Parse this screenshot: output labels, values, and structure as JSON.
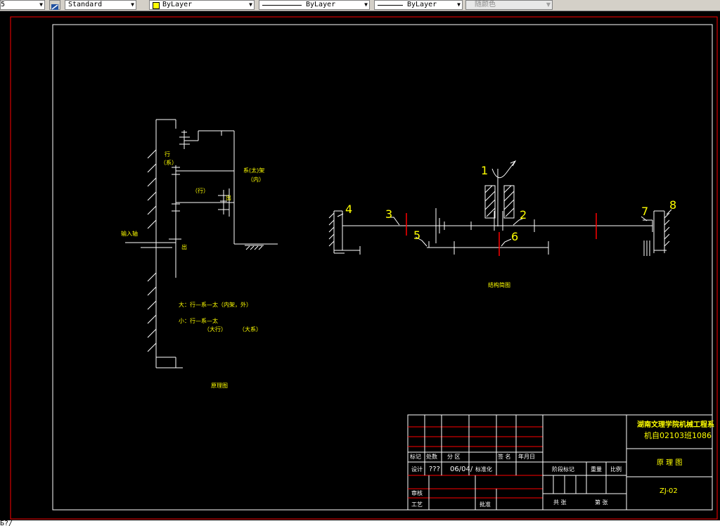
{
  "toolbar": {
    "layer_value": "5",
    "textstyle_value": "Standard",
    "color_value": "ByLayer",
    "linetype_value": "ByLayer",
    "lineweight_value": "ByLayer",
    "plotstyle_value": "随颜色"
  },
  "colors": {
    "frame": "#ff0000",
    "border": "#ffffff",
    "text": "#ffff00",
    "line": "#ffffff"
  },
  "schematic": {
    "label_xing_top": "行",
    "label_xi_paren": "（系）",
    "label_xi_tai_jia": "系(太)架",
    "label_nei": "（内）",
    "label_xing_paren": "（行）",
    "label_chu_small": "出",
    "label_input_shaft": "输入轴",
    "label_chu": "出",
    "note_da": "大：行—系—太（内架，外）",
    "note_xiao": "小：行—系—太",
    "note_daxing": "（大行）",
    "note_daxi": "（大系）",
    "caption": "原理图"
  },
  "structure": {
    "callout_1": "1",
    "callout_2": "2",
    "callout_3": "3",
    "callout_4": "4",
    "callout_5": "5",
    "callout_6": "6",
    "callout_7": "7",
    "callout_8": "8",
    "caption": "结构简图"
  },
  "titleblock": {
    "school": "湖南文理学院机械工程系",
    "class_id": "机自02103班1086",
    "hdr_mark": "标记",
    "hdr_count": "处数",
    "hdr_zone": "分 区",
    "hdr_sign": "签 名",
    "hdr_date": "年月日",
    "row_design": "设计",
    "design_name": "???",
    "design_date": "06/04/",
    "row_standard": "标准化",
    "row_review": "审核",
    "row_process": "工艺",
    "row_approve": "批准",
    "stage_mark": "阶段标记",
    "weight": "重量",
    "scale": "比例",
    "drawing_title": "原 理 图",
    "drawing_no": "ZJ-02",
    "total_sheets": "共 张",
    "sheet_no": "第 张"
  },
  "command_line": "Б?/"
}
